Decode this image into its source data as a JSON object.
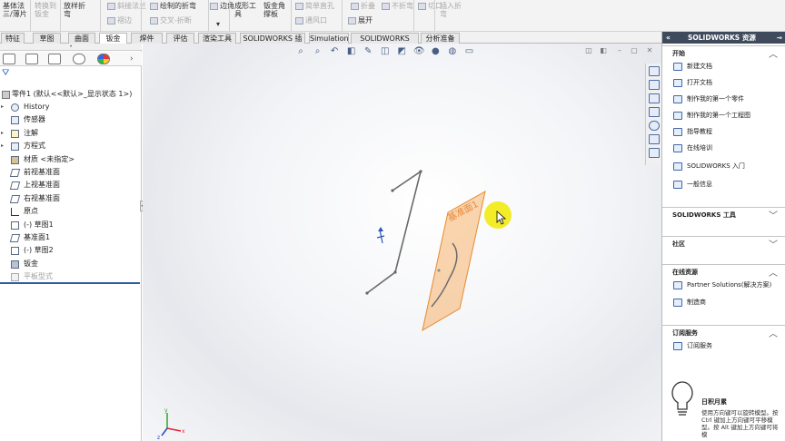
{
  "ribbon": {
    "items": [
      {
        "label": "基体法\n三/薄片",
        "dim": false
      },
      {
        "label": "转换到\n钣金",
        "dim": true
      },
      {
        "label": "放样折\n弯",
        "dim": false
      },
      {
        "label": "斜接法兰",
        "dim": true
      },
      {
        "label": "褶边",
        "dim": true
      },
      {
        "label": "绘制的折弯",
        "dim": false
      },
      {
        "label": "交叉-折断",
        "dim": true
      },
      {
        "label": "边角",
        "dim": false
      },
      {
        "label": "成形工\n具",
        "dim": false
      },
      {
        "label": "钣金角\n撑板",
        "dim": false
      },
      {
        "label": "简单直孔",
        "dim": true
      },
      {
        "label": "通风口",
        "dim": true
      },
      {
        "label": "展开",
        "dim": false
      },
      {
        "label": "折叠",
        "dim": true
      },
      {
        "label": "不折弯",
        "dim": true
      },
      {
        "label": "切口",
        "dim": true
      },
      {
        "label": "插入折\n弯",
        "dim": true
      }
    ],
    "dropdown_glyph": "▾"
  },
  "tabs": [
    {
      "label": "特征",
      "active": false
    },
    {
      "label": "草图",
      "active": false
    },
    {
      "label": "曲面",
      "active": false
    },
    {
      "label": "钣金",
      "active": true
    },
    {
      "label": "焊件",
      "active": false
    },
    {
      "label": "评估",
      "active": false
    },
    {
      "label": "渲染工具",
      "active": false
    },
    {
      "label": "SOLIDWORKS 插件",
      "active": false
    },
    {
      "label": "Simulation",
      "active": false
    },
    {
      "label": "SOLIDWORKS MBD",
      "active": false
    },
    {
      "label": "分析准备",
      "active": false
    }
  ],
  "feature_tree": {
    "root": "零件1  (默认<<默认>_显示状态 1>)",
    "items": [
      {
        "label": "History",
        "arrow": "▸",
        "icon": "history-icon",
        "dim": false
      },
      {
        "label": "传感器",
        "arrow": "",
        "icon": "sensor-icon",
        "dim": false
      },
      {
        "label": "注解",
        "arrow": "▸",
        "icon": "annotation-icon",
        "dim": false
      },
      {
        "label": "方程式",
        "arrow": "▸",
        "icon": "equation-icon",
        "dim": false
      },
      {
        "label": "材质 <未指定>",
        "arrow": "",
        "icon": "material-icon",
        "dim": false
      },
      {
        "label": "前视基准面",
        "arrow": "",
        "icon": "plane-icon",
        "dim": false
      },
      {
        "label": "上视基准面",
        "arrow": "",
        "icon": "plane-icon",
        "dim": false
      },
      {
        "label": "右视基准面",
        "arrow": "",
        "icon": "plane-icon",
        "dim": false
      },
      {
        "label": "原点",
        "arrow": "",
        "icon": "origin-icon",
        "dim": false
      },
      {
        "label": "(-) 草图1",
        "arrow": "",
        "icon": "sketch-icon",
        "dim": false
      },
      {
        "label": "基准面1",
        "arrow": "",
        "icon": "plane-icon",
        "dim": false
      },
      {
        "label": "(-) 草图2",
        "arrow": "",
        "icon": "sketch-icon",
        "dim": false
      },
      {
        "label": "钣金",
        "arrow": "",
        "icon": "sheetmetal-icon",
        "dim": false
      },
      {
        "label": "平板型式",
        "arrow": "",
        "icon": "flat-pattern-icon",
        "dim": true
      }
    ]
  },
  "viewport": {
    "plane_label": "基准面1",
    "triad_labels": {
      "x": "x",
      "y": "y",
      "z": "z"
    },
    "colors": {
      "plane_fill": "#f6b36b",
      "plane_edge": "#e88a2e",
      "sketch_line": "#666666",
      "cursor_highlight": "#f2ea12"
    }
  },
  "task_pane": {
    "title": "SOLIDWORKS 资源",
    "nav": "«",
    "sections": [
      {
        "title": "开始",
        "chevron": "︿",
        "links": [
          "新建文档",
          "打开文档",
          "制作我的第一个零件",
          "制作我的第一个工程图",
          "指导教程",
          "在线培训",
          "SOLIDWORKS 入门",
          "一般信息"
        ]
      },
      {
        "title": "SOLIDWORKS 工具",
        "chevron": "﹀",
        "links": []
      },
      {
        "title": "社区",
        "chevron": "﹀",
        "links": []
      },
      {
        "title": "在线资源",
        "chevron": "︿",
        "links": [
          "Partner Solutions(解决方案)",
          "制造商"
        ]
      },
      {
        "title": "订阅服务",
        "chevron": "︿",
        "links": [
          "订阅服务"
        ]
      }
    ],
    "tip_title": "日积月累",
    "tip_text": "使用方向键可以旋转模型。按 Ctrl 键加上方向键可平移模型。按 Alt 键加上方向键可将模"
  }
}
